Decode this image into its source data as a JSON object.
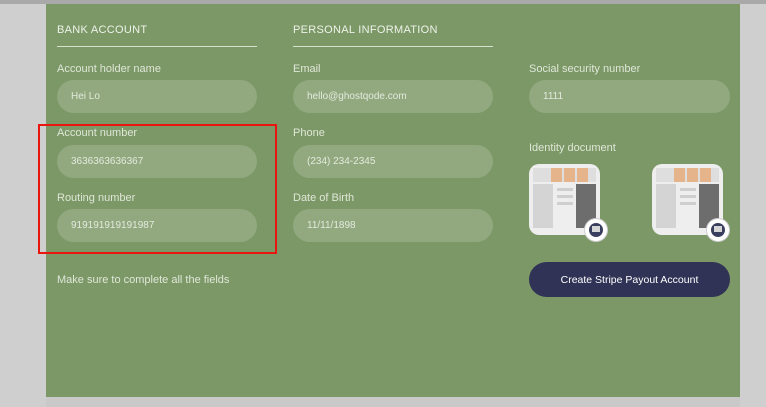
{
  "bank_account": {
    "title": "BANK ACCOUNT",
    "account_holder": {
      "label": "Account holder name",
      "value": "Hei Lo"
    },
    "account_number": {
      "label": "Account number",
      "value": "3636363636367"
    },
    "routing_number": {
      "label": "Routing number",
      "value": "919191919191987"
    },
    "note": "Make sure to complete all the fields"
  },
  "personal_info": {
    "title": "PERSONAL INFORMATION",
    "email": {
      "label": "Email",
      "value": "hello@ghostqode.com"
    },
    "phone": {
      "label": "Phone",
      "value": "(234) 234-2345"
    },
    "dob": {
      "label": "Date of Birth",
      "value": "11/11/1898"
    }
  },
  "identity": {
    "ssn": {
      "label": "Social security number",
      "value": "1111"
    },
    "document_label": "Identity document"
  },
  "submit_label": "Create Stripe Payout Account",
  "colors": {
    "panel": "#7c9867",
    "button": "#303356",
    "highlight": "#e8160f"
  }
}
